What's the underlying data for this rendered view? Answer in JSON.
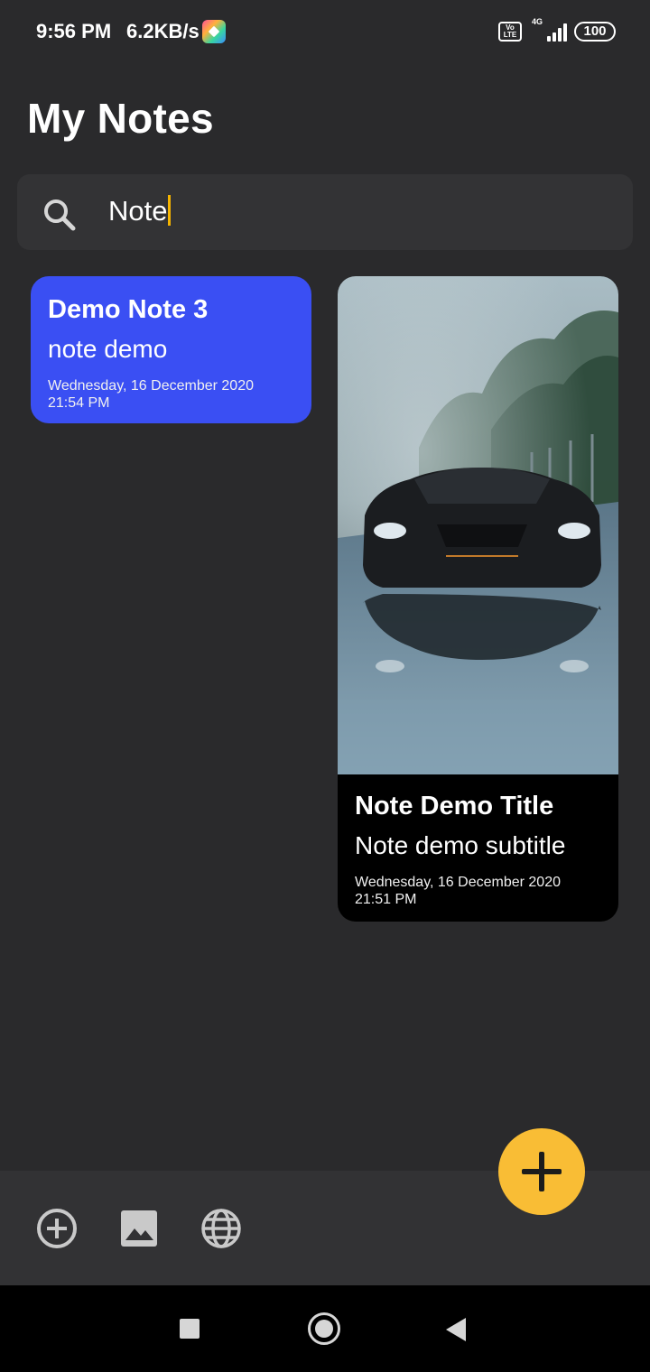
{
  "status_bar": {
    "time": "9:56 PM",
    "speed": "6.2KB/s",
    "volte_label": "Vo LTE",
    "network_type": "4G",
    "battery": "100"
  },
  "header": {
    "title": "My Notes"
  },
  "search": {
    "value": "Note",
    "icon": "search-icon"
  },
  "notes": [
    {
      "title": "Demo Note 3",
      "subtitle": "note demo",
      "date": "Wednesday, 16 December 2020",
      "time": "21:54 PM",
      "color": "#3a4ff3"
    },
    {
      "title": "Note Demo Title",
      "subtitle": "Note demo subtitle",
      "date": "Wednesday, 16 December 2020",
      "time": "21:51 PM",
      "color": "#000000",
      "image": "sports car on wet road"
    }
  ],
  "bottom_bar": {
    "icons": [
      "add-circle-icon",
      "image-icon",
      "globe-icon"
    ],
    "fab_icon": "plus-icon"
  },
  "colors": {
    "background": "#2a2a2c",
    "accent": "#f9bd35",
    "caret": "#f5b400"
  }
}
